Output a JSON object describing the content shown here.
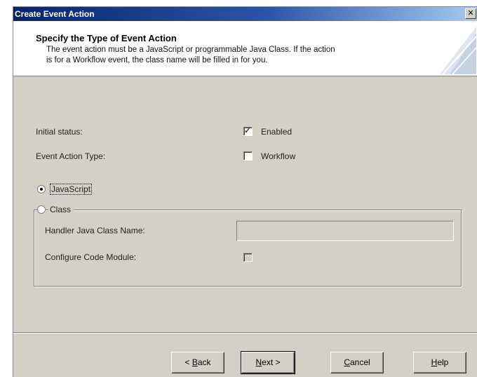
{
  "window": {
    "title": "Create Event Action",
    "close_glyph": "✕"
  },
  "header": {
    "title": "Specify the Type of Event Action",
    "description_line1": "The event action must be a JavaScript or programmable Java Class. If the action",
    "description_line2": "is for a Workflow event, the class name will be filled in for you."
  },
  "form": {
    "initial_status_label": "Initial status:",
    "enabled_label": "Enabled",
    "enabled_checked": true,
    "event_action_type_label": "Event Action Type:",
    "workflow_label": "Workflow",
    "workflow_checked": false,
    "javascript_radio_label": "JavaScript",
    "javascript_selected": true,
    "class_radio_label": "Class",
    "class_selected": false,
    "handler_class_label": "Handler Java Class Name:",
    "handler_class_value": "",
    "configure_code_module_label": "Configure Code Module:",
    "configure_code_module_checked": false
  },
  "buttons": {
    "back": {
      "prefix": "< ",
      "mnemonic": "B",
      "rest": "ack"
    },
    "next": {
      "mnemonic": "N",
      "rest": "ext >"
    },
    "cancel": {
      "mnemonic": "C",
      "rest": "ancel"
    },
    "help": {
      "mnemonic": "H",
      "rest": "elp"
    }
  },
  "icons": {
    "check": "✓",
    "close": "close-icon",
    "wizard": "wizard-graphic-icon"
  }
}
